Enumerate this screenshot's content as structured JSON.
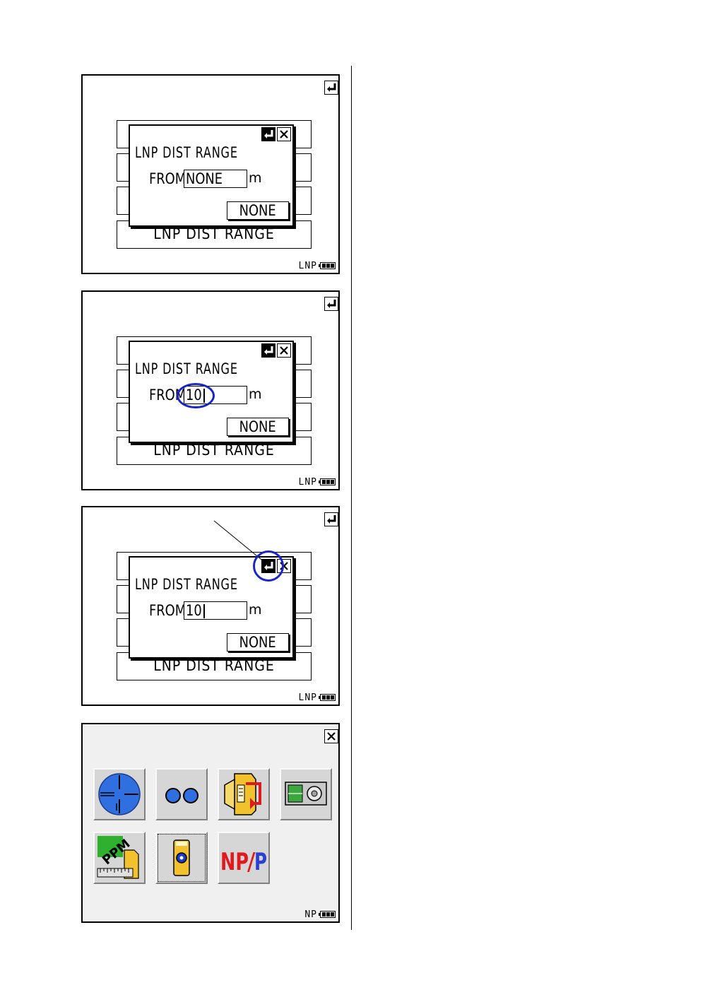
{
  "screens": [
    {
      "background_rows": {
        "bottom_label": "LNP DIST RANGE"
      },
      "dialog": {
        "title": "LNP DIST RANGE",
        "from_label": "FROM",
        "input_value": "NONE",
        "unit": "m",
        "none_button": "NONE"
      },
      "status": "LNP"
    },
    {
      "background_rows": {
        "bottom_label": "LNP DIST RANGE"
      },
      "dialog": {
        "title": "LNP DIST RANGE",
        "from_label": "FROM",
        "input_value": "10",
        "unit": "m",
        "none_button": "NONE"
      },
      "status": "LNP"
    },
    {
      "background_rows": {
        "bottom_label": "LNP DIST RANGE"
      },
      "dialog": {
        "title": "LNP DIST RANGE",
        "from_label": "FROM",
        "input_value": "10",
        "unit": "m",
        "none_button": "NONE"
      },
      "status": "LNP"
    }
  ],
  "menu_screen": {
    "status": "NP",
    "icons": [
      {
        "name": "crosshair-icon"
      },
      {
        "name": "two-circles-icon"
      },
      {
        "name": "prism-export-icon"
      },
      {
        "name": "device-panel-icon"
      },
      {
        "name": "ppm-ruler-icon"
      },
      {
        "name": "target-prism-icon"
      },
      {
        "name": "np-p-toggle-icon",
        "label_np": "NP",
        "label_slash": "/",
        "label_p": "P"
      }
    ]
  },
  "colors": {
    "highlight": "#1a25c9",
    "tile_face": "#d6d6d6",
    "icon_blue": "#2f6fe0",
    "np_red": "#e0191e",
    "p_blue": "#2b3fd1"
  }
}
